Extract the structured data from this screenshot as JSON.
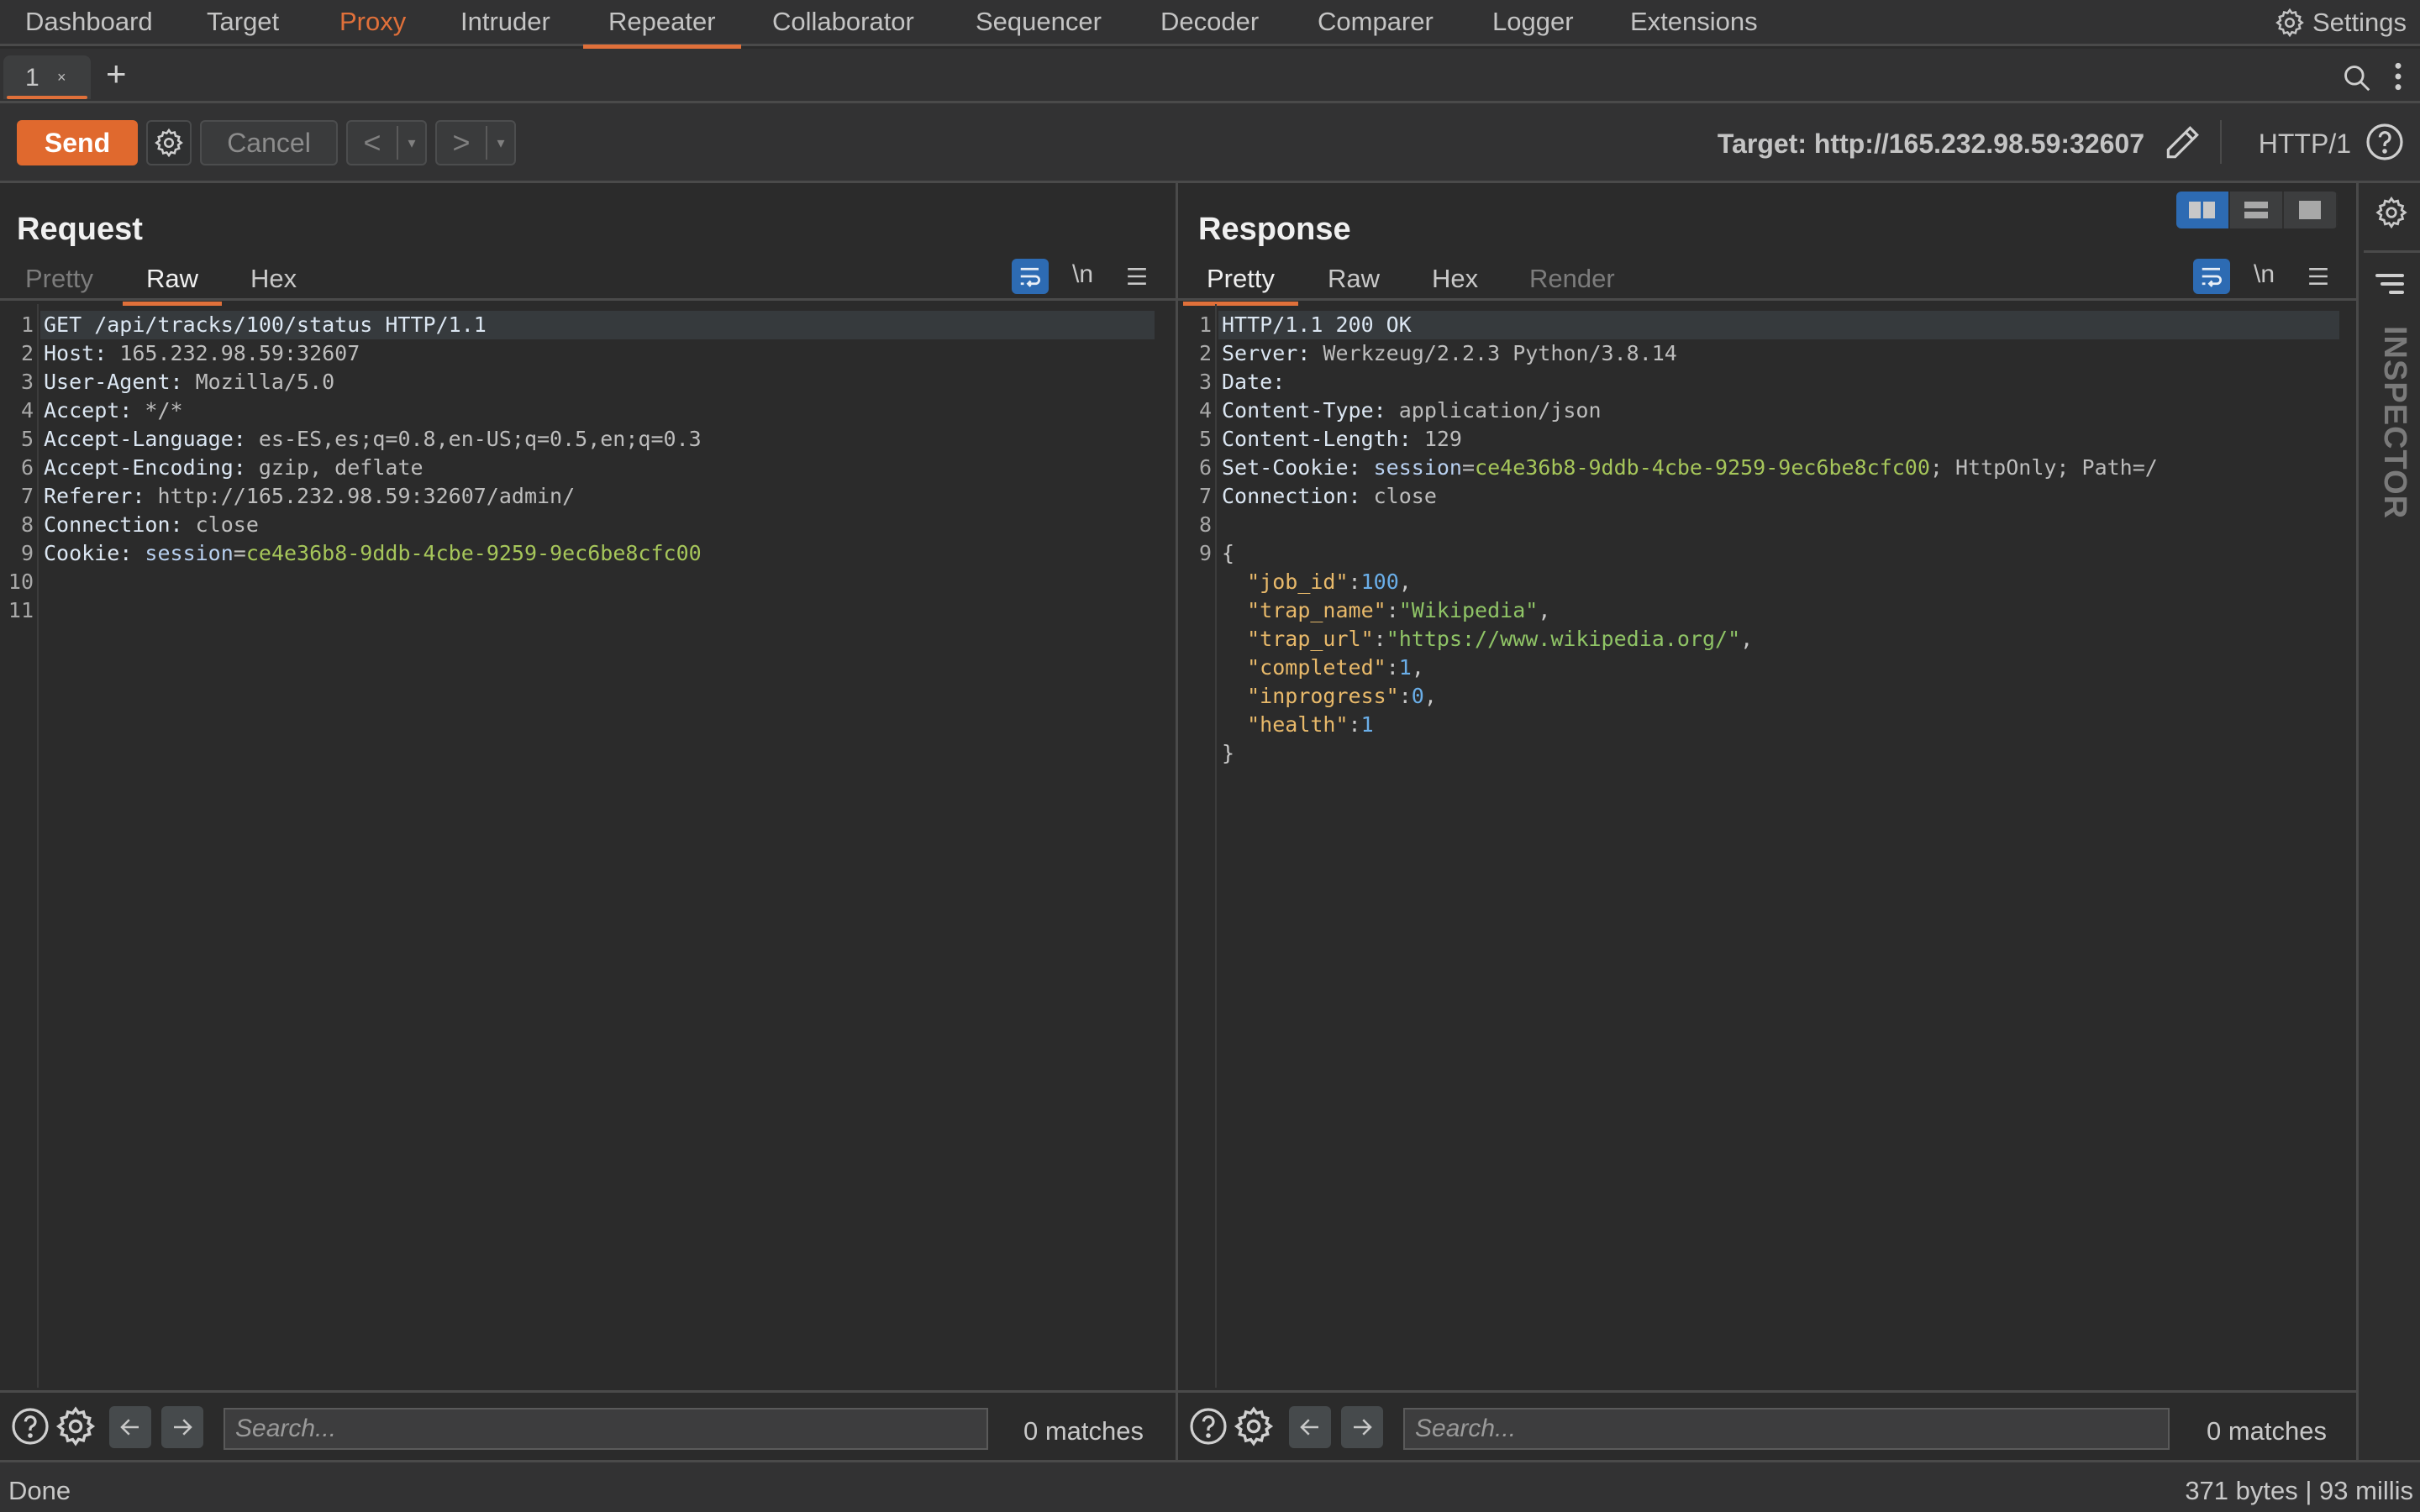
{
  "nav": {
    "items": [
      {
        "label": "Dashboard"
      },
      {
        "label": "Target"
      },
      {
        "label": "Proxy"
      },
      {
        "label": "Intruder"
      },
      {
        "label": "Repeater"
      },
      {
        "label": "Collaborator"
      },
      {
        "label": "Sequencer"
      },
      {
        "label": "Decoder"
      },
      {
        "label": "Comparer"
      },
      {
        "label": "Logger"
      },
      {
        "label": "Extensions"
      }
    ],
    "active": "Repeater",
    "highlighted": "Proxy",
    "settings_label": "Settings"
  },
  "tabs": {
    "items": [
      {
        "label": "1",
        "close": "×"
      }
    ],
    "add_label": "+"
  },
  "toolbar": {
    "send_label": "Send",
    "cancel_label": "Cancel",
    "back_label": "<",
    "forward_label": ">",
    "dropdown_glyph": "▾",
    "target_label": "Target: http://165.232.98.59:32607",
    "http_version": "HTTP/1"
  },
  "request": {
    "title": "Request",
    "tabs": [
      "Pretty",
      "Raw",
      "Hex"
    ],
    "active_tab": "Raw",
    "newline_label": "\\n",
    "lines": [
      {
        "n": "1",
        "parts": [
          {
            "t": "GET /api/tracks/100/status HTTP/1.1",
            "c": "k"
          }
        ]
      },
      {
        "n": "2",
        "parts": [
          {
            "t": "Host: ",
            "c": "k"
          },
          {
            "t": "165.232.98.59:32607",
            "c": "v"
          }
        ]
      },
      {
        "n": "3",
        "parts": [
          {
            "t": "User-Agent: ",
            "c": "k"
          },
          {
            "t": "Mozilla/5.0",
            "c": "v"
          }
        ]
      },
      {
        "n": "4",
        "parts": [
          {
            "t": "Accept: ",
            "c": "k"
          },
          {
            "t": "*/*",
            "c": "v"
          }
        ]
      },
      {
        "n": "5",
        "parts": [
          {
            "t": "Accept-Language: ",
            "c": "k"
          },
          {
            "t": "es-ES,es;q=0.8,en-US;q=0.5,en;q=0.3",
            "c": "v"
          }
        ]
      },
      {
        "n": "6",
        "parts": [
          {
            "t": "Accept-Encoding: ",
            "c": "k"
          },
          {
            "t": "gzip, deflate",
            "c": "v"
          }
        ]
      },
      {
        "n": "7",
        "parts": [
          {
            "t": "Referer: ",
            "c": "k"
          },
          {
            "t": "http://165.232.98.59:32607/admin/",
            "c": "v"
          }
        ]
      },
      {
        "n": "8",
        "parts": [
          {
            "t": "Connection: ",
            "c": "k"
          },
          {
            "t": "close",
            "c": "v"
          }
        ]
      },
      {
        "n": "9",
        "parts": [
          {
            "t": "Cookie: ",
            "c": "k"
          },
          {
            "t": "session",
            "c": "ck"
          },
          {
            "t": "=",
            "c": "v"
          },
          {
            "t": "ce4e36b8-9ddb-4cbe-9259-9ec6be8cfc00",
            "c": "cv"
          }
        ]
      },
      {
        "n": "10",
        "parts": []
      },
      {
        "n": "11",
        "parts": []
      }
    ],
    "search_placeholder": "Search...",
    "matches": "0 matches"
  },
  "response": {
    "title": "Response",
    "tabs": [
      "Pretty",
      "Raw",
      "Hex",
      "Render"
    ],
    "active_tab": "Pretty",
    "newline_label": "\\n",
    "lines": [
      {
        "n": "1",
        "parts": [
          {
            "t": "HTTP/1.1 200 OK",
            "c": "k"
          }
        ]
      },
      {
        "n": "2",
        "parts": [
          {
            "t": "Server: ",
            "c": "k"
          },
          {
            "t": "Werkzeug/2.2.3 Python/3.8.14",
            "c": "v"
          }
        ]
      },
      {
        "n": "3",
        "parts": [
          {
            "t": "Date: ",
            "c": "k"
          }
        ]
      },
      {
        "n": "4",
        "parts": [
          {
            "t": "Content-Type: ",
            "c": "k"
          },
          {
            "t": "application/json",
            "c": "v"
          }
        ]
      },
      {
        "n": "5",
        "parts": [
          {
            "t": "Content-Length: ",
            "c": "k"
          },
          {
            "t": "129",
            "c": "v"
          }
        ]
      },
      {
        "n": "6",
        "parts": [
          {
            "t": "Set-Cookie: ",
            "c": "k"
          },
          {
            "t": "session",
            "c": "ck"
          },
          {
            "t": "=",
            "c": "v"
          },
          {
            "t": "ce4e36b8-9ddb-4cbe-9259-9ec6be8cfc00",
            "c": "cv"
          },
          {
            "t": "; HttpOnly; Path=/",
            "c": "v"
          }
        ]
      },
      {
        "n": "7",
        "parts": [
          {
            "t": "Connection: ",
            "c": "k"
          },
          {
            "t": "close",
            "c": "v"
          }
        ]
      },
      {
        "n": "8",
        "parts": []
      },
      {
        "n": "9",
        "parts": [
          {
            "t": "{",
            "c": "jp"
          }
        ]
      },
      {
        "n": "",
        "parts": [
          {
            "t": "  ",
            "c": "jp"
          },
          {
            "t": "\"job_id\"",
            "c": "jk"
          },
          {
            "t": ":",
            "c": "jp"
          },
          {
            "t": "100",
            "c": "jn"
          },
          {
            "t": ",",
            "c": "jp"
          }
        ]
      },
      {
        "n": "",
        "parts": [
          {
            "t": "  ",
            "c": "jp"
          },
          {
            "t": "\"trap_name\"",
            "c": "jk"
          },
          {
            "t": ":",
            "c": "jp"
          },
          {
            "t": "\"Wikipedia\"",
            "c": "js"
          },
          {
            "t": ",",
            "c": "jp"
          }
        ]
      },
      {
        "n": "",
        "parts": [
          {
            "t": "  ",
            "c": "jp"
          },
          {
            "t": "\"trap_url\"",
            "c": "jk"
          },
          {
            "t": ":",
            "c": "jp"
          },
          {
            "t": "\"https://www.wikipedia.org/\"",
            "c": "js"
          },
          {
            "t": ",",
            "c": "jp"
          }
        ]
      },
      {
        "n": "",
        "parts": [
          {
            "t": "  ",
            "c": "jp"
          },
          {
            "t": "\"completed\"",
            "c": "jk"
          },
          {
            "t": ":",
            "c": "jp"
          },
          {
            "t": "1",
            "c": "jn"
          },
          {
            "t": ",",
            "c": "jp"
          }
        ]
      },
      {
        "n": "",
        "parts": [
          {
            "t": "  ",
            "c": "jp"
          },
          {
            "t": "\"inprogress\"",
            "c": "jk"
          },
          {
            "t": ":",
            "c": "jp"
          },
          {
            "t": "0",
            "c": "jn"
          },
          {
            "t": ",",
            "c": "jp"
          }
        ]
      },
      {
        "n": "",
        "parts": [
          {
            "t": "  ",
            "c": "jp"
          },
          {
            "t": "\"health\"",
            "c": "jk"
          },
          {
            "t": ":",
            "c": "jp"
          },
          {
            "t": "1",
            "c": "jn"
          }
        ]
      },
      {
        "n": "",
        "parts": [
          {
            "t": "}",
            "c": "jp"
          }
        ]
      }
    ],
    "search_placeholder": "Search...",
    "matches": "0 matches"
  },
  "inspector": {
    "label": "INSPECTOR"
  },
  "status": {
    "left": "Done",
    "right": "371 bytes | 93 millis"
  },
  "colors": {
    "accent": "#e0703a",
    "send": "#e0692e",
    "toggle_blue": "#2d6bb3"
  }
}
